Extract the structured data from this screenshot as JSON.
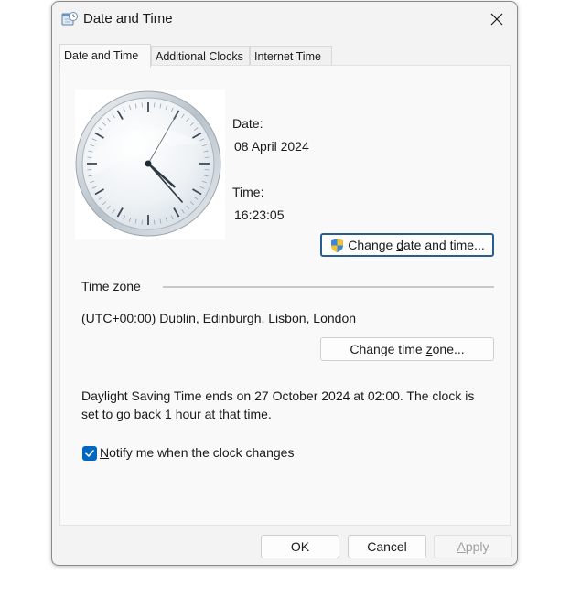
{
  "window": {
    "title": "Date and Time",
    "icon": "calendar-clock-icon"
  },
  "tabs": [
    {
      "label": "Date and Time",
      "active": true
    },
    {
      "label": "Additional Clocks",
      "active": false
    },
    {
      "label": "Internet Time",
      "active": false
    }
  ],
  "date": {
    "label": "Date:",
    "value": "08 April 2024"
  },
  "time": {
    "label": "Time:",
    "value": "16:23:05"
  },
  "change_datetime_button": {
    "pre": "Change ",
    "accel": "d",
    "post": "ate and time...",
    "icon": "uac-shield-icon"
  },
  "timezone": {
    "section_label": "Time zone",
    "value": "(UTC+00:00) Dublin, Edinburgh, Lisbon, London",
    "button_pre": "Change time ",
    "button_accel": "z",
    "button_post": "one..."
  },
  "dst": {
    "line1": "Daylight Saving Time ends on 27 October 2024 at 02:00. The clock is",
    "line2": "set to go back 1 hour at that time."
  },
  "notify": {
    "checked": true,
    "accel": "N",
    "rest": "otify me when the clock changes"
  },
  "footer": {
    "ok": "OK",
    "cancel": "Cancel",
    "apply_accel": "A",
    "apply_rest": "pply"
  },
  "colors": {
    "accent": "#0067c0",
    "focus_border": "#2a5d8f"
  }
}
